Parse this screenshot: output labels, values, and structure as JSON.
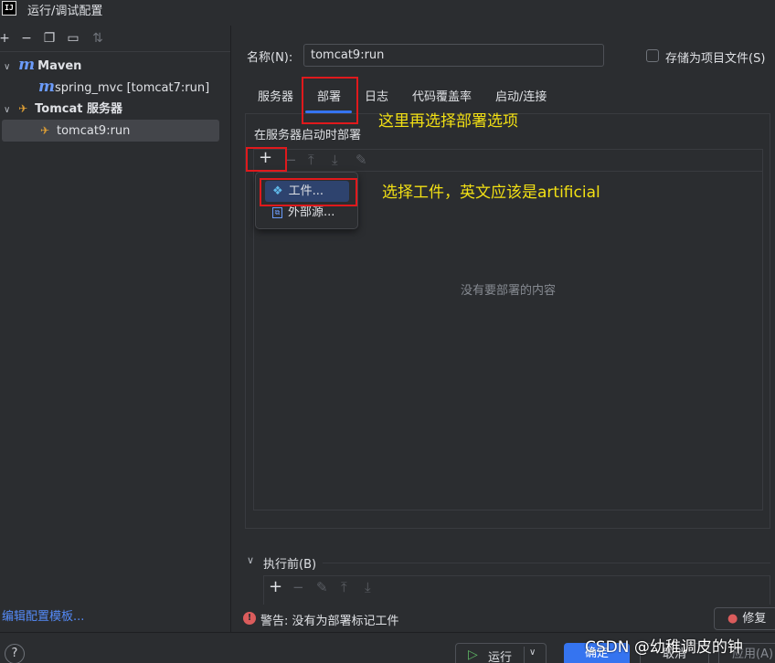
{
  "window": {
    "title": "运行/调试配置",
    "logo": "IJ"
  },
  "left_toolbar": {
    "icons": [
      "add-icon",
      "remove-icon",
      "copy-icon",
      "new-folder-icon",
      "sort-icon"
    ]
  },
  "tree": [
    {
      "label": "Maven",
      "icon": "maven-icon",
      "expanded": true
    },
    {
      "label": "spring_mvc [tomcat7:run]",
      "icon": "maven-icon"
    },
    {
      "label": "Tomcat 服务器",
      "icon": "tomcat-icon",
      "expanded": true
    },
    {
      "label": "tomcat9:run",
      "icon": "tomcat-config-icon",
      "selected": true
    }
  ],
  "edit_templates": "编辑配置模板...",
  "form": {
    "name_label": "名称(N):",
    "name_value": "tomcat9:run",
    "save_label": "存储为项目文件(S)"
  },
  "tabs": [
    {
      "label": "服务器"
    },
    {
      "label": "部署",
      "active": true
    },
    {
      "label": "日志"
    },
    {
      "label": "代码覆盖率"
    },
    {
      "label": "启动/连接"
    }
  ],
  "deploy": {
    "label": "在服务器启动时部署",
    "empty_text": "没有要部署的内容",
    "toolbar_icons": [
      "add-icon",
      "remove-icon",
      "move-up-icon",
      "move-down-icon",
      "edit-icon"
    ]
  },
  "popup": {
    "items": [
      {
        "label": "工件...",
        "icon": "artifact-icon",
        "selected": true
      },
      {
        "label": "外部源...",
        "icon": "external-source-icon"
      }
    ]
  },
  "annotations": {
    "tab_note": "这里再选择部署选项",
    "artifact_note": "选择工件，英文应该是artificial"
  },
  "before_launch": {
    "label": "执行前(B)",
    "toolbar_icons": [
      "add-icon",
      "remove-icon",
      "edit-icon",
      "move-up-icon",
      "move-down-icon"
    ]
  },
  "warning": {
    "text": "警告: 没有为部署标记工件",
    "fix_label": "修复"
  },
  "buttons": {
    "help": "?",
    "run": "运行",
    "ok": "确定",
    "cancel": "取消",
    "apply": "应用(A)"
  },
  "watermark": "CSDN @幼稚调皮的钟",
  "colors": {
    "background": "#2b2d30",
    "accent": "#3574f0",
    "annotation": "#f2e014",
    "highlight_box": "#e0191c"
  }
}
